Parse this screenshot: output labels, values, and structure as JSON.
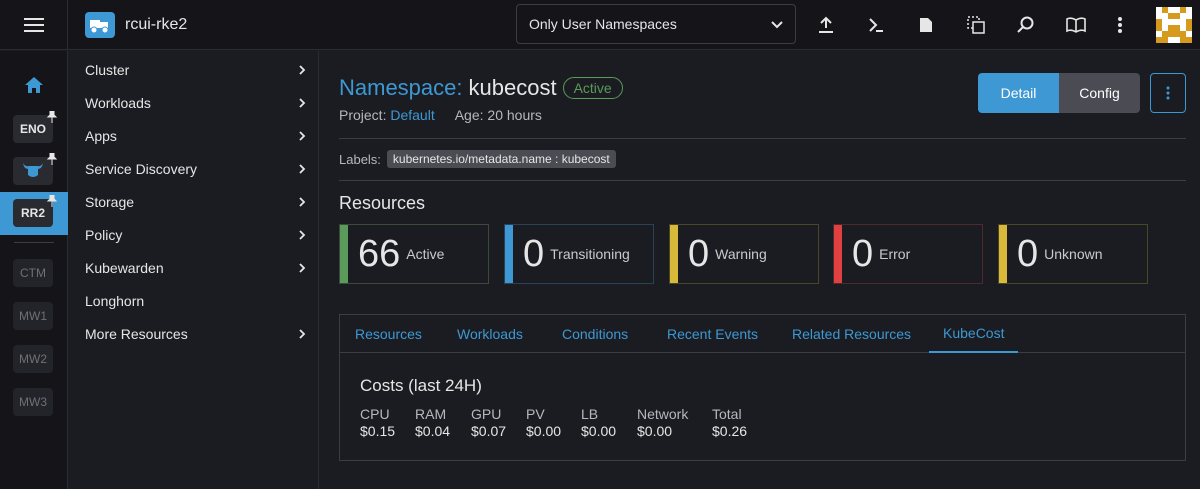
{
  "header": {
    "cluster_name": "rcui-rke2",
    "namespace_filter": "Only User Namespaces",
    "icons": [
      "import-yaml-icon",
      "kubectl-shell-icon",
      "kubeconfig-download-icon",
      "copy-kubeconfig-icon",
      "search-icon",
      "docs-icon",
      "more-vert-icon"
    ]
  },
  "rail": {
    "clusters": [
      {
        "label": "ENO",
        "pinned": true
      },
      {
        "label": "",
        "pinned": true,
        "icon": "bull-logo-icon"
      },
      {
        "label": "RR2",
        "pinned": true,
        "active": true
      },
      {
        "label": "CTM"
      },
      {
        "label": "MW1"
      },
      {
        "label": "MW2"
      },
      {
        "label": "MW3"
      }
    ]
  },
  "nav": {
    "items": [
      {
        "label": "Cluster",
        "expandable": true
      },
      {
        "label": "Workloads",
        "expandable": true
      },
      {
        "label": "Apps",
        "expandable": true
      },
      {
        "label": "Service Discovery",
        "expandable": true
      },
      {
        "label": "Storage",
        "expandable": true
      },
      {
        "label": "Policy",
        "expandable": true
      },
      {
        "label": "Kubewarden",
        "expandable": true
      },
      {
        "label": "Longhorn",
        "expandable": false
      },
      {
        "label": "More Resources",
        "expandable": true
      }
    ]
  },
  "page": {
    "title_prefix": "Namespace:",
    "title_name": "kubecost",
    "state": "Active",
    "project_label": "Project:",
    "project_value": "Default",
    "age_text": "Age: 20 hours",
    "detail_button": "Detail",
    "config_button": "Config",
    "labels_caption": "Labels:",
    "label_pill": "kubernetes.io/metadata.name : kubecost",
    "resources_title": "Resources"
  },
  "resource_cards": [
    {
      "count": "66",
      "label": "Active",
      "color": "#5a9a5a"
    },
    {
      "count": "0",
      "label": "Transitioning",
      "color": "#3d98d3"
    },
    {
      "count": "0",
      "label": "Warning",
      "color": "#d8b93a"
    },
    {
      "count": "0",
      "label": "Error",
      "color": "#e04040"
    },
    {
      "count": "0",
      "label": "Unknown",
      "color": "#d8b93a"
    }
  ],
  "tabs": [
    {
      "label": "Resources"
    },
    {
      "label": "Workloads"
    },
    {
      "label": "Conditions"
    },
    {
      "label": "Recent Events"
    },
    {
      "label": "Related Resources"
    },
    {
      "label": "KubeCost",
      "active": true
    }
  ],
  "costs": {
    "title": "Costs (last 24H)",
    "columns": [
      {
        "name": "CPU",
        "value": "$0.15"
      },
      {
        "name": "RAM",
        "value": "$0.04"
      },
      {
        "name": "GPU",
        "value": "$0.07"
      },
      {
        "name": "PV",
        "value": "$0.00"
      },
      {
        "name": "LB",
        "value": "$0.00"
      },
      {
        "name": "Network",
        "value": "$0.00"
      },
      {
        "name": "Total",
        "value": "$0.26"
      }
    ]
  },
  "colors": {
    "accent": "#3d98d3",
    "active_green": "#5a9a5a"
  }
}
